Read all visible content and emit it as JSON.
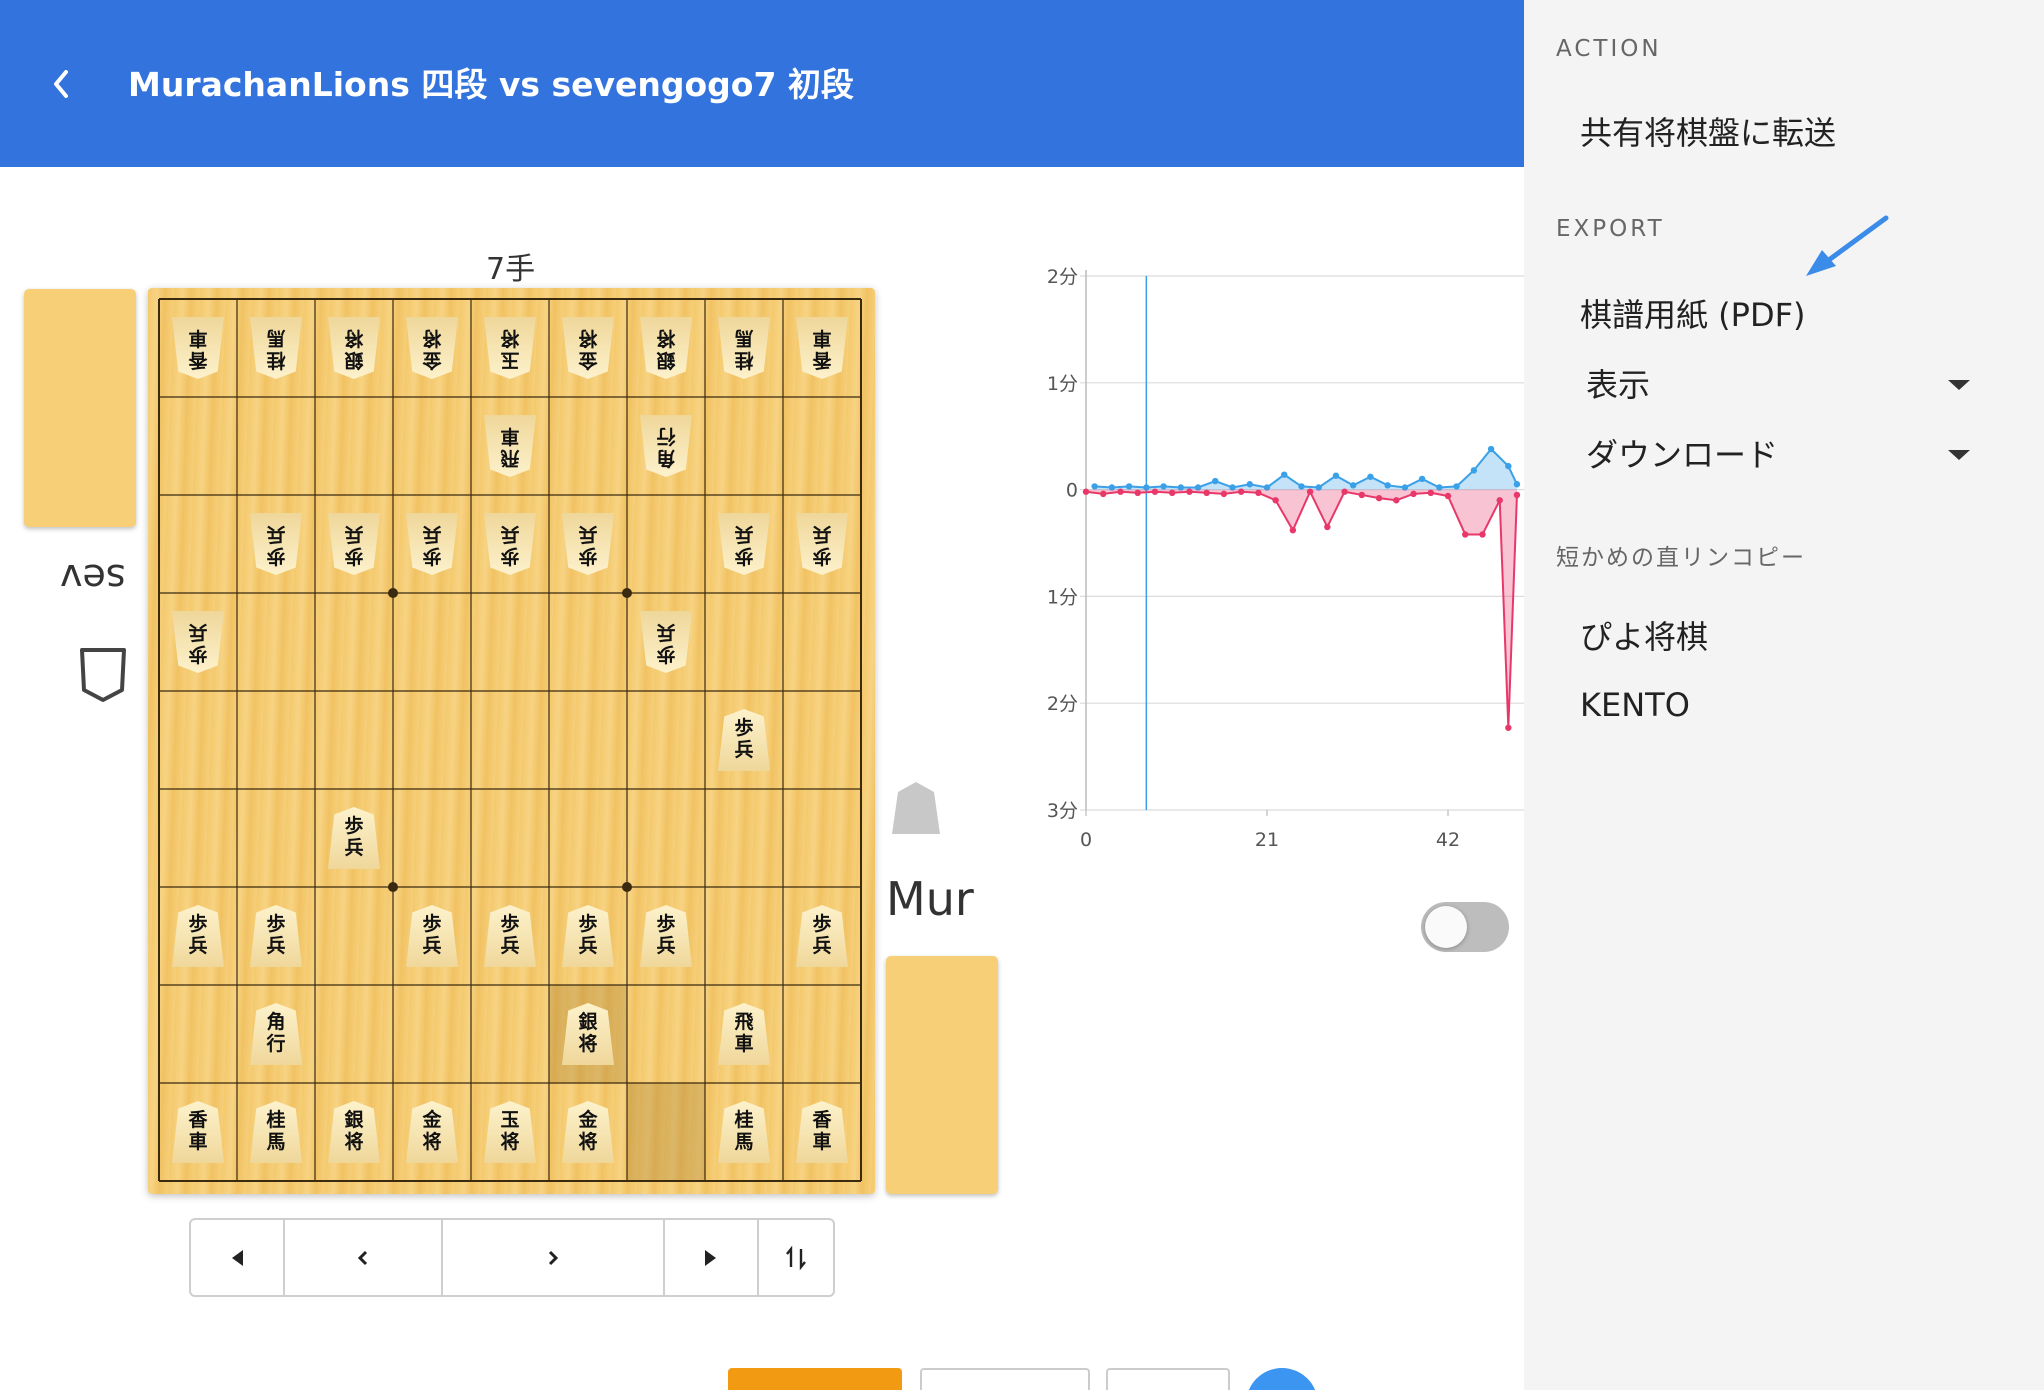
{
  "header": {
    "title": "MurachanLions 四段 vs sevengogo7 初段",
    "background": "#3373dd"
  },
  "board": {
    "move_label": "7手",
    "gote_player": "sev",
    "sente_player": "Mur",
    "gote_pieces": [
      {
        "file": 9,
        "rank": 1,
        "text": "香車"
      },
      {
        "file": 8,
        "rank": 1,
        "text": "桂馬"
      },
      {
        "file": 7,
        "rank": 1,
        "text": "銀将"
      },
      {
        "file": 6,
        "rank": 1,
        "text": "金将"
      },
      {
        "file": 5,
        "rank": 1,
        "text": "玉将"
      },
      {
        "file": 4,
        "rank": 1,
        "text": "金将"
      },
      {
        "file": 3,
        "rank": 1,
        "text": "銀将"
      },
      {
        "file": 2,
        "rank": 1,
        "text": "桂馬"
      },
      {
        "file": 1,
        "rank": 1,
        "text": "香車"
      },
      {
        "file": 5,
        "rank": 2,
        "text": "飛車"
      },
      {
        "file": 3,
        "rank": 2,
        "text": "角行"
      },
      {
        "file": 8,
        "rank": 3,
        "text": "歩兵"
      },
      {
        "file": 7,
        "rank": 3,
        "text": "歩兵"
      },
      {
        "file": 6,
        "rank": 3,
        "text": "歩兵"
      },
      {
        "file": 5,
        "rank": 3,
        "text": "歩兵"
      },
      {
        "file": 4,
        "rank": 3,
        "text": "歩兵"
      },
      {
        "file": 2,
        "rank": 3,
        "text": "歩兵"
      },
      {
        "file": 1,
        "rank": 3,
        "text": "歩兵"
      },
      {
        "file": 9,
        "rank": 4,
        "text": "歩兵"
      },
      {
        "file": 3,
        "rank": 4,
        "text": "歩兵"
      }
    ],
    "sente_pieces": [
      {
        "file": 2,
        "rank": 5,
        "text": "歩兵"
      },
      {
        "file": 7,
        "rank": 6,
        "text": "歩兵"
      },
      {
        "file": 9,
        "rank": 7,
        "text": "歩兵"
      },
      {
        "file": 8,
        "rank": 7,
        "text": "歩兵"
      },
      {
        "file": 6,
        "rank": 7,
        "text": "歩兵"
      },
      {
        "file": 5,
        "rank": 7,
        "text": "歩兵"
      },
      {
        "file": 4,
        "rank": 7,
        "text": "歩兵"
      },
      {
        "file": 3,
        "rank": 7,
        "text": "歩兵"
      },
      {
        "file": 1,
        "rank": 7,
        "text": "歩兵"
      },
      {
        "file": 8,
        "rank": 8,
        "text": "角行"
      },
      {
        "file": 4,
        "rank": 8,
        "text": "銀将"
      },
      {
        "file": 2,
        "rank": 8,
        "text": "飛車"
      },
      {
        "file": 9,
        "rank": 9,
        "text": "香車"
      },
      {
        "file": 8,
        "rank": 9,
        "text": "桂馬"
      },
      {
        "file": 7,
        "rank": 9,
        "text": "銀将"
      },
      {
        "file": 6,
        "rank": 9,
        "text": "金将"
      },
      {
        "file": 5,
        "rank": 9,
        "text": "玉将"
      },
      {
        "file": 4,
        "rank": 9,
        "text": "金将"
      },
      {
        "file": 2,
        "rank": 9,
        "text": "桂馬"
      },
      {
        "file": 1,
        "rank": 9,
        "text": "香車"
      }
    ],
    "highlighted_squares": [
      {
        "file": 4,
        "rank": 8
      },
      {
        "file": 3,
        "rank": 9
      }
    ]
  },
  "nav": {
    "first": "⏴",
    "prev": "‹",
    "next": "›",
    "last": "⏵",
    "flip": "⇅"
  },
  "chart_data": {
    "type": "area",
    "y_tick_labels": [
      "2分",
      "1分",
      "0",
      "1分",
      "2分",
      "3分"
    ],
    "y_ticks": [
      2,
      1,
      0,
      -1,
      -2,
      -3
    ],
    "x_tick_labels": [
      "0",
      "21",
      "42"
    ],
    "x_ticks": [
      0,
      21,
      42
    ],
    "ylim": [
      -3,
      2
    ],
    "xlim": [
      0,
      50
    ],
    "current_move": 7,
    "grid": true,
    "series": [
      {
        "color": "#3aa0e8",
        "x": [
          1,
          3,
          5,
          7,
          9,
          11,
          13,
          15,
          17,
          19,
          21,
          23,
          25,
          27,
          29,
          31,
          33,
          35,
          37,
          39,
          41,
          43,
          45,
          47,
          49,
          50
        ],
        "y": [
          0.03,
          0.02,
          0.03,
          0.02,
          0.03,
          0.02,
          0.02,
          0.08,
          0.02,
          0.05,
          0.02,
          0.14,
          0.03,
          0.02,
          0.13,
          0.04,
          0.12,
          0.04,
          0.02,
          0.1,
          0.02,
          0.03,
          0.18,
          0.38,
          0.22,
          0.05
        ]
      },
      {
        "color": "#e8386a",
        "x": [
          0,
          2,
          4,
          6,
          8,
          10,
          12,
          14,
          16,
          18,
          20,
          22,
          24,
          26,
          28,
          30,
          32,
          34,
          36,
          38,
          40,
          42,
          44,
          46,
          48,
          49,
          50
        ],
        "y": [
          -0.02,
          -0.04,
          -0.02,
          -0.03,
          -0.02,
          -0.03,
          -0.02,
          -0.03,
          -0.04,
          -0.02,
          -0.03,
          -0.1,
          -0.38,
          -0.02,
          -0.35,
          -0.02,
          -0.05,
          -0.08,
          -0.1,
          -0.04,
          -0.03,
          -0.06,
          -0.42,
          -0.42,
          -0.1,
          -2.23,
          -0.05
        ]
      }
    ]
  },
  "panel": {
    "action_head": "ACTION",
    "transfer_label": "共有将棋盤に転送",
    "export_head": "EXPORT",
    "pdf_label": "棋譜用紙 (PDF)",
    "display_label": "表示",
    "download_label": "ダウンロード",
    "shortlink_head": "短かめの直リンコピー",
    "piyo_label": "ぴよ将棋",
    "kento_label": "KENTO"
  },
  "annotation_color": "#3b8be8"
}
